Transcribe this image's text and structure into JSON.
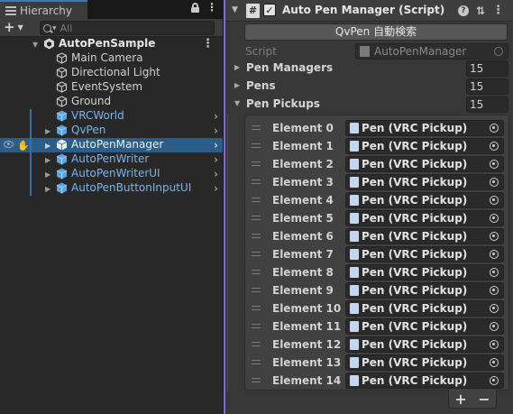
{
  "hierarchy": {
    "tab_label": "Hierarchy",
    "add_label": "+",
    "search_placeholder": "All",
    "scene_name": "AutoPenSample",
    "items": [
      {
        "label": "Main Camera",
        "type": "object"
      },
      {
        "label": "Directional Light",
        "type": "object"
      },
      {
        "label": "EventSystem",
        "type": "object"
      },
      {
        "label": "Ground",
        "type": "object"
      },
      {
        "label": "VRCWorld",
        "type": "prefab"
      },
      {
        "label": "QvPen",
        "type": "prefab"
      },
      {
        "label": "AutoPenManager",
        "type": "prefab",
        "selected": true
      },
      {
        "label": "AutoPenWriter",
        "type": "prefab"
      },
      {
        "label": "AutoPenWriterUI",
        "type": "prefab"
      },
      {
        "label": "AutoPenButtonInputUI",
        "type": "prefab"
      }
    ]
  },
  "inspector": {
    "component_title": "Auto Pen Manager (Script)",
    "script_icon_glyph": "#",
    "button_label": "QvPen 自動検索",
    "script_label": "Script",
    "script_value": "AutoPenManager",
    "properties": [
      {
        "name": "Pen Managers",
        "count": "15",
        "expanded": false
      },
      {
        "name": "Pens",
        "count": "15",
        "expanded": false
      },
      {
        "name": "Pen Pickups",
        "count": "15",
        "expanded": true
      }
    ],
    "elements": [
      {
        "name": "Element 0",
        "value": "Pen (VRC Pickup)"
      },
      {
        "name": "Element 1",
        "value": "Pen (VRC Pickup)"
      },
      {
        "name": "Element 2",
        "value": "Pen (VRC Pickup)"
      },
      {
        "name": "Element 3",
        "value": "Pen (VRC Pickup)"
      },
      {
        "name": "Element 4",
        "value": "Pen (VRC Pickup)"
      },
      {
        "name": "Element 5",
        "value": "Pen (VRC Pickup)"
      },
      {
        "name": "Element 6",
        "value": "Pen (VRC Pickup)"
      },
      {
        "name": "Element 7",
        "value": "Pen (VRC Pickup)"
      },
      {
        "name": "Element 8",
        "value": "Pen (VRC Pickup)"
      },
      {
        "name": "Element 9",
        "value": "Pen (VRC Pickup)"
      },
      {
        "name": "Element 10",
        "value": "Pen (VRC Pickup)"
      },
      {
        "name": "Element 11",
        "value": "Pen (VRC Pickup)"
      },
      {
        "name": "Element 12",
        "value": "Pen (VRC Pickup)"
      },
      {
        "name": "Element 13",
        "value": "Pen (VRC Pickup)"
      },
      {
        "name": "Element 14",
        "value": "Pen (VRC Pickup)"
      }
    ],
    "add_element_label": "+",
    "remove_element_label": "−"
  },
  "colors": {
    "selection": "#2c5d87",
    "prefab_text": "#7cb4ee",
    "tab_accent": "#3a79bb",
    "splitter_accent": "#7d6fcb"
  }
}
